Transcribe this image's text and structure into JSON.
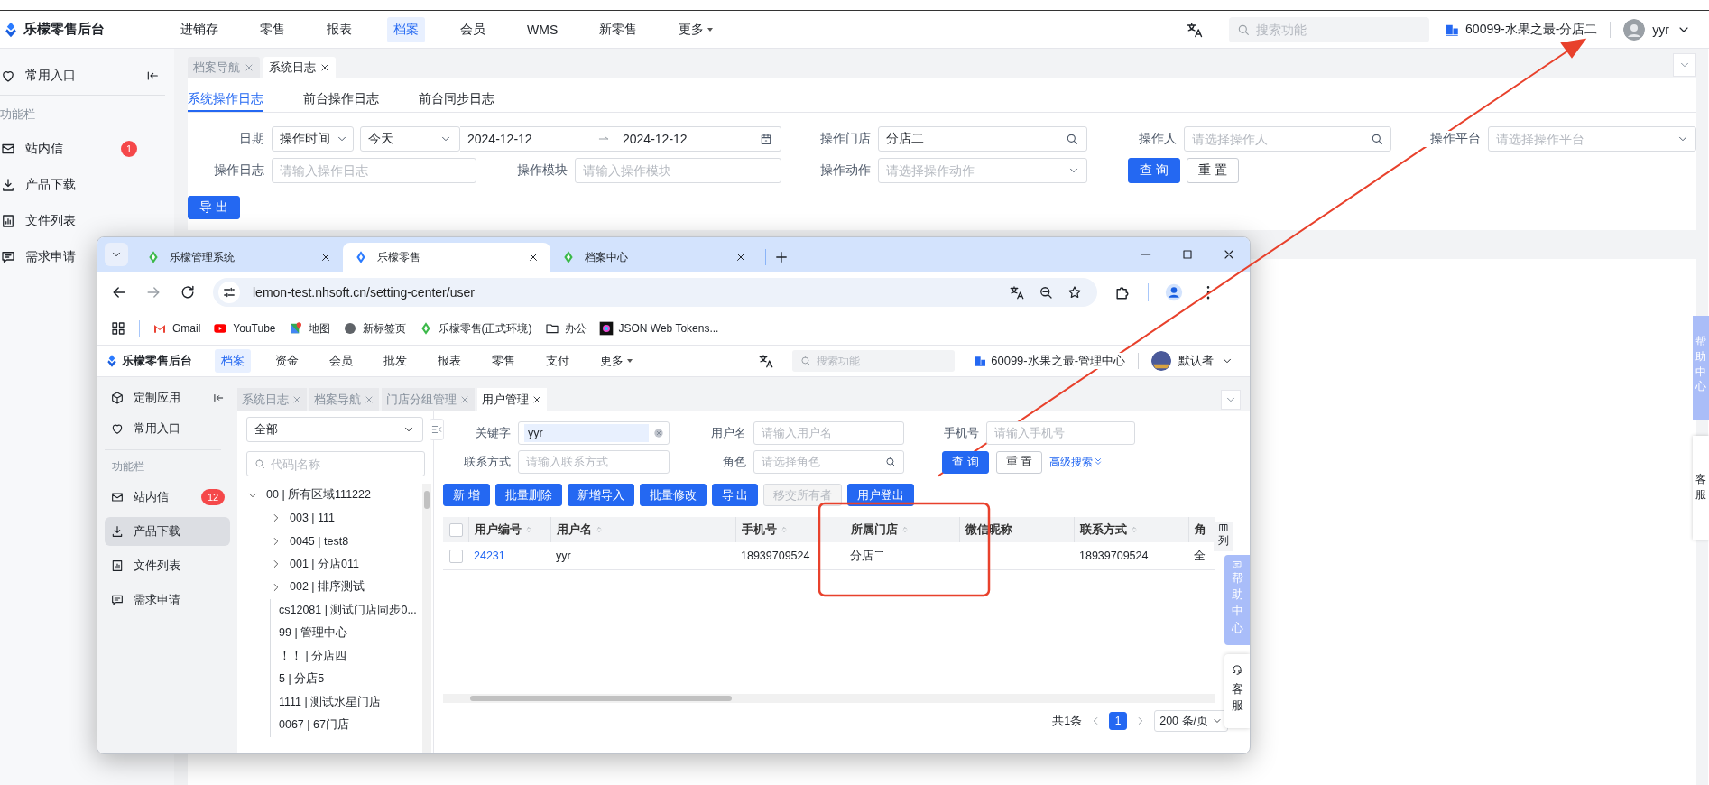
{
  "outer": {
    "brand": "乐檬零售后台",
    "nav": [
      {
        "label": "进销存",
        "selected": false
      },
      {
        "label": "零售",
        "selected": false
      },
      {
        "label": "报表",
        "selected": false
      },
      {
        "label": "档案",
        "selected": true
      },
      {
        "label": "会员",
        "selected": false
      },
      {
        "label": "WMS",
        "selected": false
      },
      {
        "label": "新零售",
        "selected": false
      },
      {
        "label": "更多",
        "selected": false,
        "dropdown": true
      }
    ],
    "search_placeholder": "搜索功能",
    "store": "60099-水果之最-分店二",
    "user": "yyr",
    "sidebar": {
      "pinned": "常用入口",
      "section": "功能栏",
      "items": [
        {
          "label": "站内信",
          "badge": "1",
          "selected": false
        },
        {
          "label": "产品下载",
          "selected": false
        },
        {
          "label": "文件列表",
          "selected": false
        },
        {
          "label": "需求申请",
          "selected": false
        }
      ]
    },
    "tabs": [
      {
        "label": "档案导航",
        "selected": false
      },
      {
        "label": "系统日志",
        "selected": true
      }
    ],
    "subtabs": [
      {
        "label": "系统操作日志",
        "selected": true
      },
      {
        "label": "前台操作日志",
        "selected": false
      },
      {
        "label": "前台同步日志",
        "selected": false
      }
    ],
    "filters": {
      "date_label": "日期",
      "date_type": "操作时间",
      "date_preset": "今天",
      "date_start": "2024-12-12",
      "date_end": "2024-12-12",
      "store_label": "操作门店",
      "store_value": "分店二",
      "operator_label": "操作人",
      "operator_placeholder": "请选择操作人",
      "platform_label": "操作平台",
      "platform_placeholder": "请选择操作平台",
      "log_label": "操作日志",
      "log_placeholder": "请输入操作日志",
      "module_label": "操作模块",
      "module_placeholder": "请输入操作模块",
      "action_label": "操作动作",
      "action_placeholder": "请选择操作动作",
      "query": "查 询",
      "reset": "重 置"
    },
    "export": "导 出",
    "help": "帮助中心",
    "service": "客服"
  },
  "browser": {
    "tabs": [
      {
        "title": "乐檬管理系统",
        "selected": false
      },
      {
        "title": "乐檬零售",
        "selected": true
      },
      {
        "title": "档案中心",
        "selected": false
      }
    ],
    "url": "lemon-test.nhsoft.cn/setting-center/user",
    "bookmarks": [
      "Gmail",
      "YouTube",
      "地图",
      "新标签页",
      "乐檬零售(正式环境)",
      "办公",
      "JSON Web Tokens..."
    ],
    "app": {
      "brand": "乐檬零售后台",
      "nav": [
        {
          "label": "档案",
          "selected": true
        },
        {
          "label": "资金",
          "selected": false
        },
        {
          "label": "会员",
          "selected": false
        },
        {
          "label": "批发",
          "selected": false
        },
        {
          "label": "报表",
          "selected": false
        },
        {
          "label": "零售",
          "selected": false
        },
        {
          "label": "支付",
          "selected": false
        },
        {
          "label": "更多",
          "selected": false,
          "dropdown": true
        }
      ],
      "search_placeholder": "搜索功能",
      "store": "60099-水果之最-管理中心",
      "user": "默认者",
      "sidebar": {
        "custom": "定制应用",
        "pinned": "常用入口",
        "section": "功能栏",
        "items": [
          {
            "label": "站内信",
            "badge": "12",
            "selected": false
          },
          {
            "label": "产品下载",
            "selected": true
          },
          {
            "label": "文件列表",
            "selected": false
          },
          {
            "label": "需求申请",
            "selected": false
          }
        ]
      },
      "tabs": [
        {
          "label": "系统日志",
          "selected": false
        },
        {
          "label": "档案导航",
          "selected": false
        },
        {
          "label": "门店分组管理",
          "selected": false
        },
        {
          "label": "用户管理",
          "selected": true
        }
      ],
      "tree": {
        "scope": "全部",
        "search_placeholder": "代码|名称",
        "nodes": [
          {
            "label": "00 | 所有区域111222",
            "expanded": true,
            "children": [
              {
                "label": "003 | 111",
                "expanded": false
              },
              {
                "label": "0045 | test8",
                "expanded": false
              },
              {
                "label": "001 | 分店011",
                "expanded": false
              },
              {
                "label": "002 | 排序测试",
                "expanded": false
              },
              {
                "label": "cs12081 | 测试门店同步0..."
              },
              {
                "label": "99 | 管理中心"
              },
              {
                "label": "！！ | 分店四"
              },
              {
                "label": "5 | 分店5"
              },
              {
                "label": "1111 | 测试水星门店"
              },
              {
                "label": "0067 | 67门店"
              }
            ]
          }
        ]
      },
      "form": {
        "keyword_label": "关键字",
        "keyword_value": "yyr",
        "username_label": "用户名",
        "username_placeholder": "请输入用户名",
        "phone_label": "手机号",
        "phone_placeholder": "请输入手机号",
        "contact_label": "联系方式",
        "contact_placeholder": "请输入联系方式",
        "role_label": "角色",
        "role_placeholder": "请选择角色",
        "query": "查 询",
        "reset": "重 置",
        "advanced": "高级搜索"
      },
      "actions": [
        {
          "label": "新 增",
          "disabled": false
        },
        {
          "label": "批量删除",
          "disabled": false
        },
        {
          "label": "新增导入",
          "disabled": false
        },
        {
          "label": "批量修改",
          "disabled": false
        },
        {
          "label": "导 出",
          "disabled": false
        },
        {
          "label": "移交所有者",
          "disabled": true
        },
        {
          "label": "用户登出",
          "disabled": false
        }
      ],
      "table": {
        "header_checked": false,
        "columns": [
          {
            "label": "用户编号",
            "sortable": true
          },
          {
            "label": "用户名",
            "sortable": true
          },
          {
            "label": "手机号",
            "sortable": true
          },
          {
            "label": "所属门店",
            "sortable": true
          },
          {
            "label": "微信昵称",
            "sortable": false
          },
          {
            "label": "联系方式",
            "sortable": true
          },
          {
            "label": "角",
            "sortable": false
          }
        ],
        "rows": [
          {
            "checked": false,
            "cells": [
              "24231",
              "yyr",
              "18939709524",
              "分店二",
              null,
              "18939709524",
              "全"
            ]
          }
        ]
      },
      "column_settings": "列",
      "help": "帮助中心",
      "service": "客服",
      "pagination": {
        "total": "共1条",
        "pages": [
          {
            "label": "1",
            "selected": true
          }
        ],
        "page_size": "200 条/页"
      }
    }
  }
}
